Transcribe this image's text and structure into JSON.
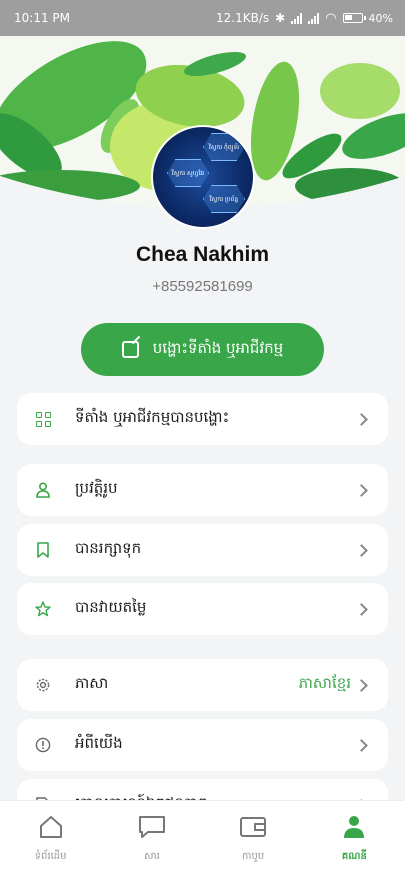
{
  "status_bar": {
    "time": "10:11 PM",
    "network_speed": "12.1KB/s",
    "battery": "40%"
  },
  "avatar": {
    "hex_texts": [
      "វិស្វករ កុំព្យូទ័រ",
      "វិស្វករ សូហ្វវែរ",
      "វិស្វករ ប្រព័ន្ធ"
    ]
  },
  "profile": {
    "name": "Chea Nakhim",
    "phone": "+85592581699"
  },
  "post_button": {
    "label": "បង្ហោះទីតាំង ឬអាជីវកម្ម"
  },
  "menu": [
    {
      "icon": "grid-icon",
      "label": "ទីតាំង ឬអាជីវកម្មបានបង្ហោះ",
      "value": ""
    },
    {
      "icon": "user-icon",
      "label": "ប្រវត្តិរូប",
      "value": ""
    },
    {
      "icon": "bookmark-icon",
      "label": "បានរក្សាទុក",
      "value": ""
    },
    {
      "icon": "star-icon",
      "label": "បានវាយតម្លៃ",
      "value": ""
    },
    {
      "icon": "gear-icon",
      "label": "ភាសា",
      "value": "ភាសាខ្មែរ"
    },
    {
      "icon": "info-icon",
      "label": "អំពីយើង",
      "value": ""
    },
    {
      "icon": "document-icon",
      "label": "គោលការណ៍ឯកជនភាព",
      "value": ""
    }
  ],
  "bottom_nav": [
    {
      "icon": "home-icon",
      "label": "ទំព័រដើម",
      "active": false
    },
    {
      "icon": "message-icon",
      "label": "សារ",
      "active": false
    },
    {
      "icon": "wallet-icon",
      "label": "កាបូប",
      "active": false
    },
    {
      "icon": "person-icon",
      "label": "គណនី",
      "active": true
    }
  ],
  "colors": {
    "accent": "#3aa64a",
    "status_bar": "#9e9e9e",
    "background": "#f3f4f6"
  }
}
